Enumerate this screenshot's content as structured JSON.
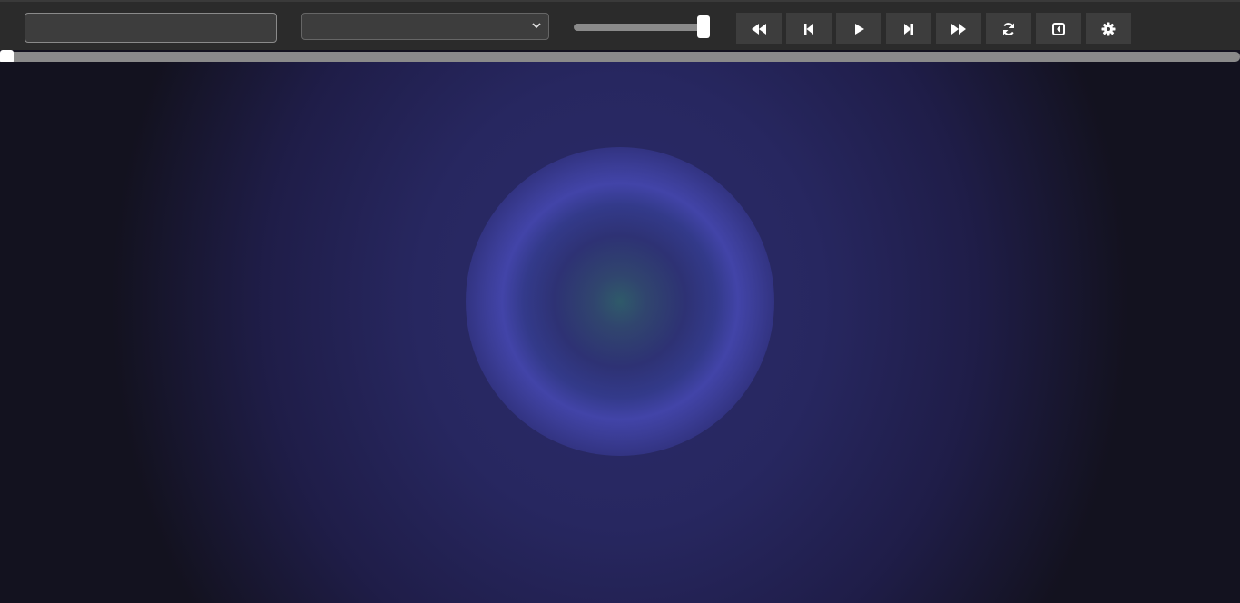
{
  "toolbar": {
    "text_input": {
      "value": "",
      "placeholder": ""
    },
    "select": {
      "selected": ""
    },
    "slider": {
      "value_fraction": 1.0
    },
    "buttons": [
      {
        "name": "rewind-button",
        "icon": "fast-backward-icon"
      },
      {
        "name": "previous-button",
        "icon": "skip-back-icon"
      },
      {
        "name": "play-button",
        "icon": "play-icon"
      },
      {
        "name": "next-button",
        "icon": "skip-forward-icon"
      },
      {
        "name": "fast-forward-button",
        "icon": "fast-forward-icon"
      },
      {
        "name": "refresh-button",
        "icon": "refresh-icon"
      },
      {
        "name": "collapse-button",
        "icon": "collapse-left-icon"
      },
      {
        "name": "settings-button",
        "icon": "gear-icon"
      }
    ]
  },
  "timeline": {
    "position_fraction": 0.0
  },
  "colors": {
    "toolbar_bg": "#2b2b2b",
    "button_bg": "#3d3d3d",
    "track": "#8a8a8a",
    "thumb": "#ffffff",
    "stage_dark": "#13121f",
    "stage_mid": "#2b2b6a",
    "ring": "#4244a8",
    "core": "#2f5a6a"
  }
}
